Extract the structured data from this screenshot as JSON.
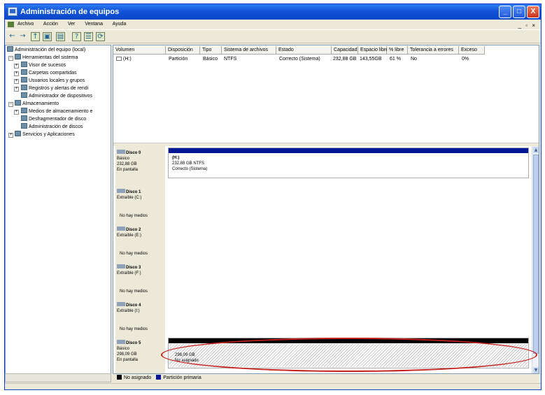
{
  "window": {
    "title": "Administración de equipos",
    "minimize": "_",
    "maximize": "□",
    "close": "X"
  },
  "menu": [
    "Archivo",
    "Acción",
    "Ver",
    "Ventana",
    "Ayuda"
  ],
  "mdi_controls": "_ ▫ ×",
  "toolbar_icons": [
    "back-icon",
    "forward-icon",
    "up-icon",
    "show-hide-tree-icon",
    "export-icon",
    "help-icon",
    "properties-icon",
    "refresh-icon"
  ],
  "tree": {
    "root": "Administración del equipo (local)",
    "system_tools": "Herramientas del sistema",
    "event_viewer": "Visor de sucesos",
    "shared_folders": "Carpetas compartidas",
    "local_users": "Usuarios locales y grupos",
    "perf_logs": "Registros y alertas de rendi",
    "device_manager": "Administrador de dispositivos",
    "storage": "Almacenamiento",
    "removable_storage": "Medios de almacenamiento e",
    "defrag": "Desfragmentador de disco",
    "disk_management": "Administración de discos",
    "services": "Servicios y Aplicaciones"
  },
  "volumes": {
    "headers": [
      "Volumen",
      "Disposición",
      "Tipo",
      "Sistema de archivos",
      "Estado",
      "Capacidad",
      "Espacio libre",
      "% libre",
      "Tolerancia a errores",
      "Exceso"
    ],
    "rows": [
      {
        "volume": "(H:)",
        "layout": "Partición",
        "type": "Básico",
        "fs": "NTFS",
        "status": "Correcto (Sistema)",
        "capacity": "232,88 GB",
        "free": "143,55GB",
        "pct": "61 %",
        "fault": "No",
        "overhead": "0%"
      }
    ]
  },
  "disks": [
    {
      "name": "Disco 0",
      "line1": "Básico",
      "line2": "232,88 GB",
      "line3": "En pantalla",
      "vol_name": "(H:)",
      "vol_size": "232,88 GB NTFS",
      "vol_status": "Correcto (Sistema)"
    },
    {
      "name": "Disco 1",
      "line1": "Extraíble (C:)",
      "media": "No hay medios"
    },
    {
      "name": "Disco 2",
      "line1": "Extraíble (E:)",
      "media": "No hay medios"
    },
    {
      "name": "Disco 3",
      "line1": "Extraíble (F:)",
      "media": "No hay medios"
    },
    {
      "name": "Disco 4",
      "line1": "Extraíble (I:)",
      "media": "No hay medios"
    },
    {
      "name": "Disco 5",
      "line1": "Básico",
      "line2": "298,09 GB",
      "line3": "En pantalla",
      "vol_size": "298,09 GB",
      "vol_status": "No asignado"
    }
  ],
  "legend": {
    "unallocated": "No asignado",
    "primary": "Partición primaria"
  },
  "colors": {
    "primary": "#001694",
    "unallocated": "#000000",
    "annotation": "#c4211d"
  }
}
